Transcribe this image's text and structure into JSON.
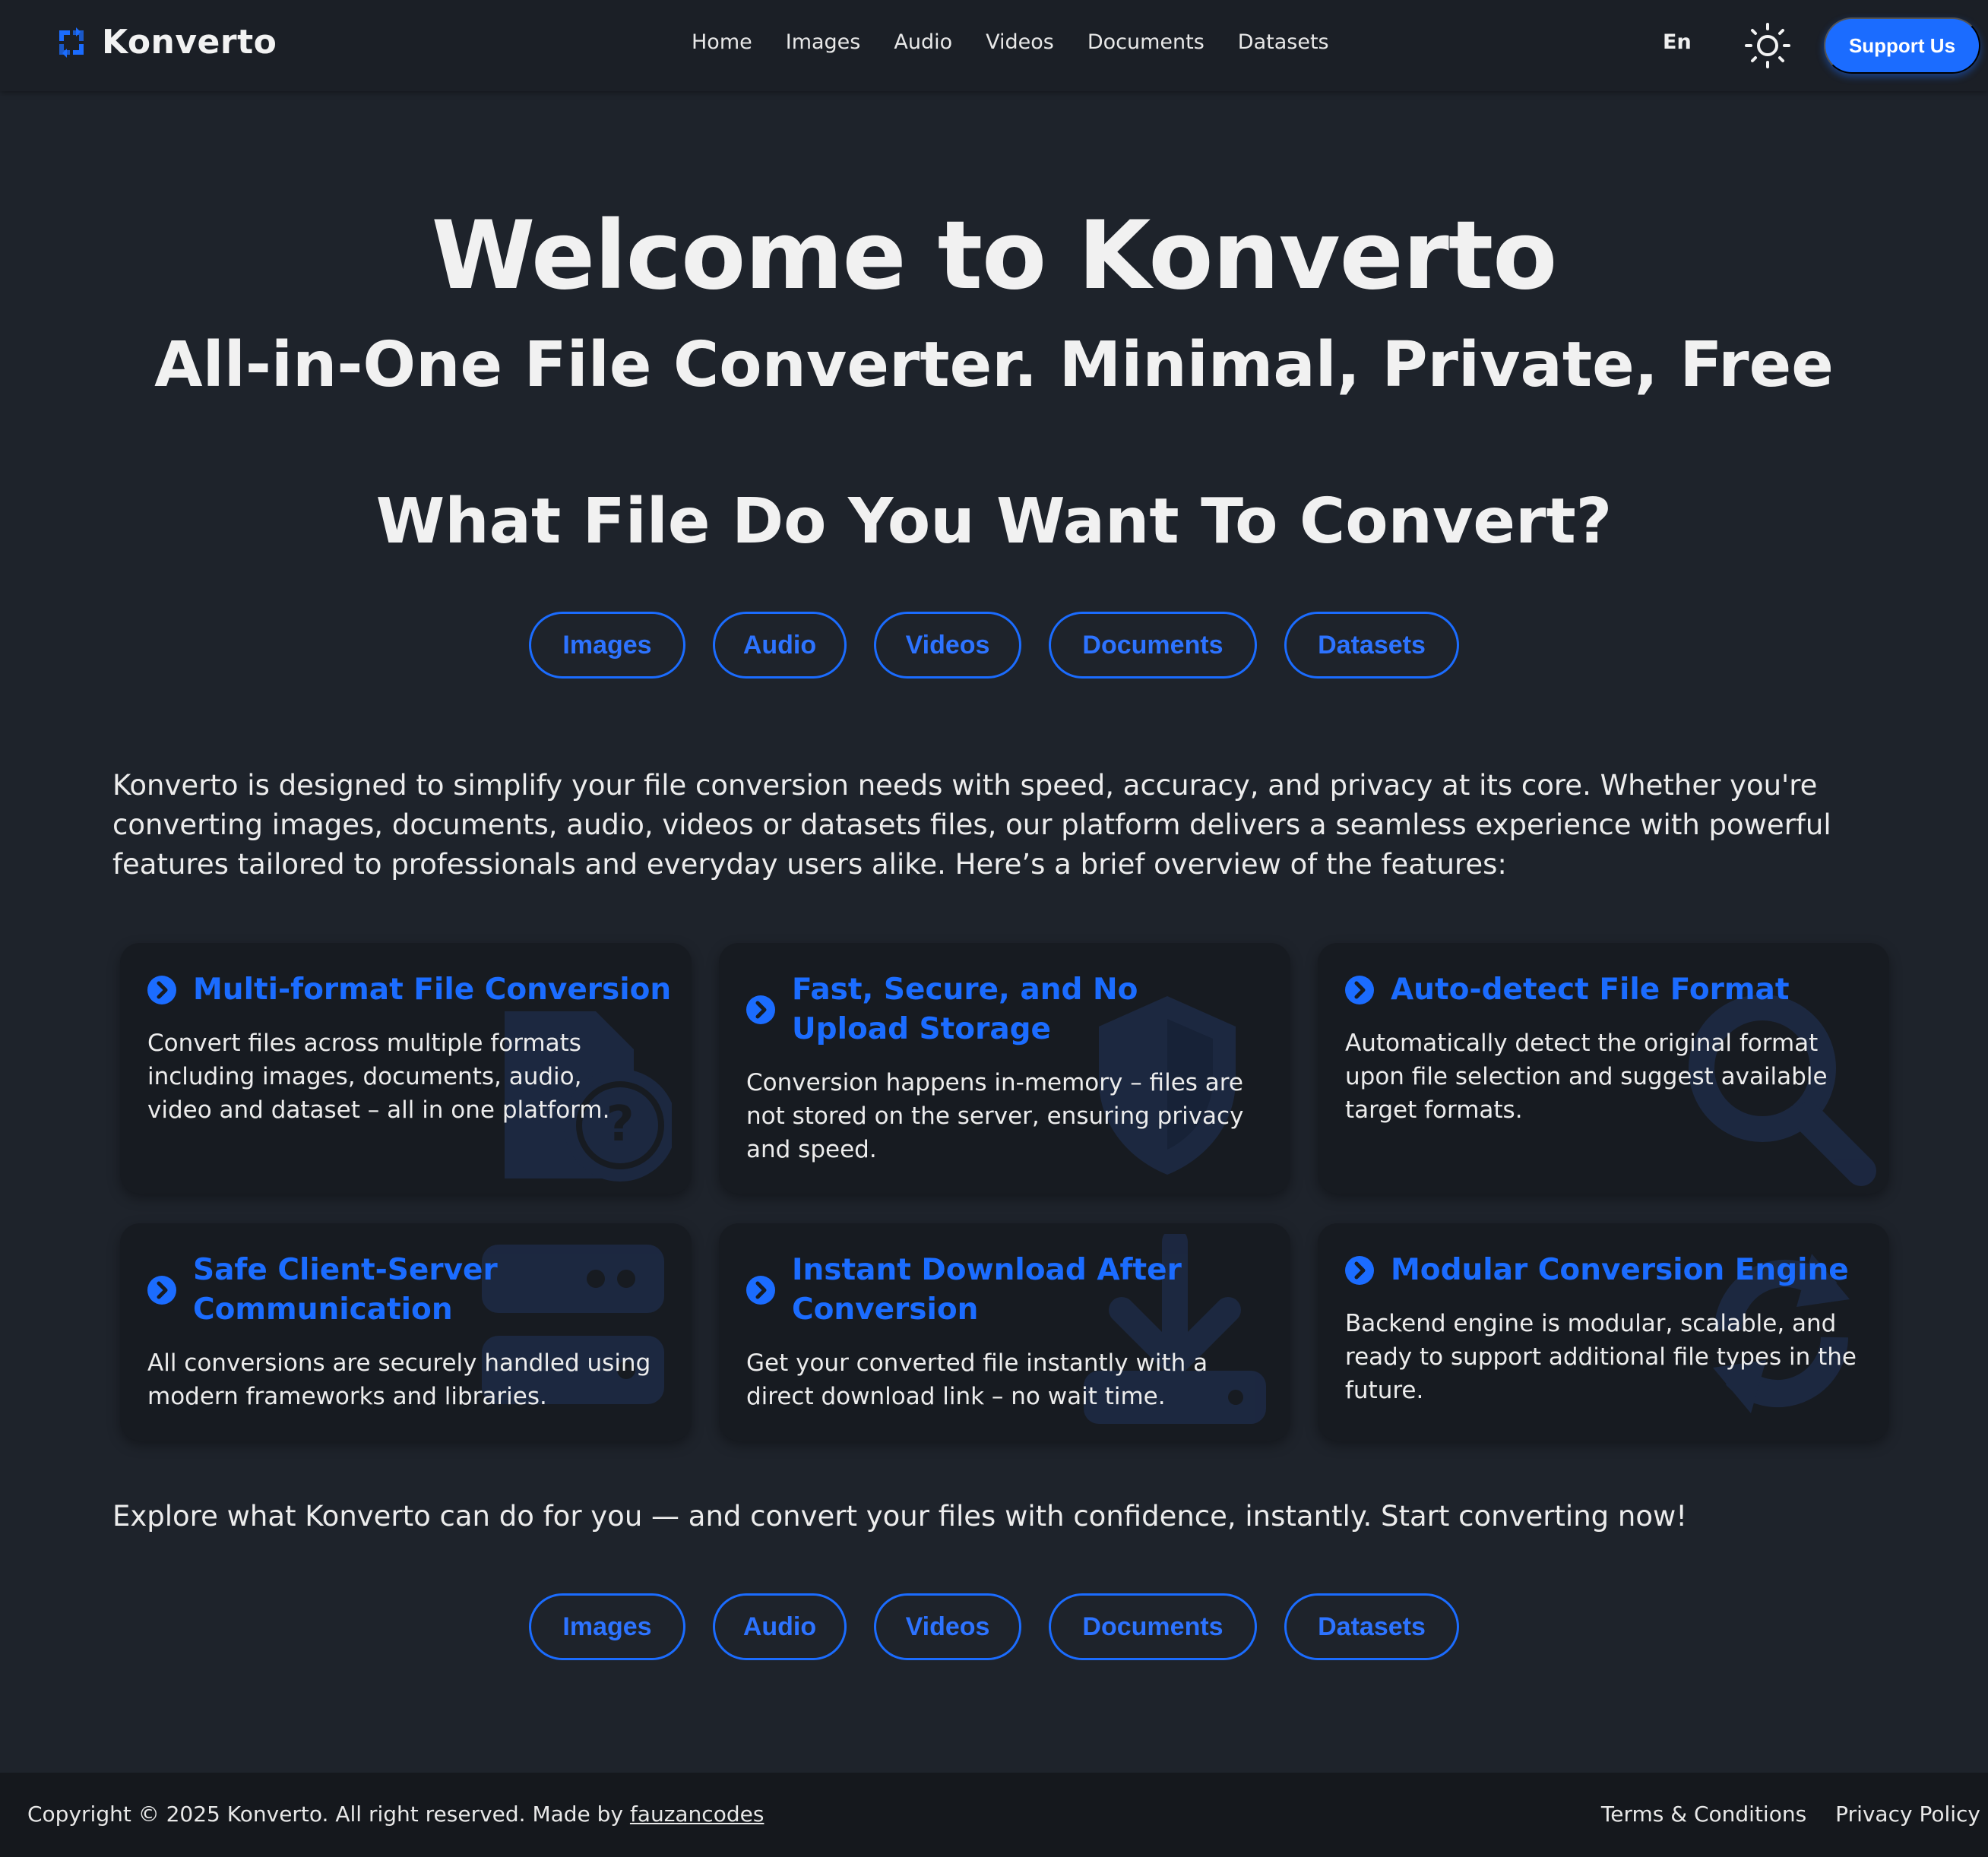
{
  "brand": {
    "name": "Konverto",
    "logo_icon": "refresh-square-icon"
  },
  "nav": {
    "links": [
      "Home",
      "Images",
      "Audio",
      "Videos",
      "Documents",
      "Datasets"
    ],
    "language": "En",
    "theme_icon": "sun-icon",
    "support_label": "Support Us"
  },
  "hero": {
    "title": "Welcome to Konverto",
    "subtitle": "All-in-One File Converter. Minimal, Private, Free",
    "question": "What File Do You Want To Convert?"
  },
  "categories": [
    "Images",
    "Audio",
    "Videos",
    "Documents",
    "Datasets"
  ],
  "intro": "Konverto is designed to simplify your file conversion needs with speed, accuracy, and privacy at its core. Whether you're converting images, documents, audio, videos or datasets files, our platform delivers a seamless experience with powerful features tailored to professionals and everyday users alike. Here’s a brief overview of the features:",
  "features": [
    {
      "title": "Multi-format File Conversion",
      "description": "Convert files across multiple formats including images, documents, audio, video and dataset – all in one platform.",
      "icon": "file-question-icon"
    },
    {
      "title": "Fast, Secure, and No Upload Storage",
      "description": "Conversion happens in-memory – files are not stored on the server, ensuring privacy and speed.",
      "icon": "shield-icon"
    },
    {
      "title": "Auto-detect File Format",
      "description": "Automatically detect the original format upon file selection and suggest available target formats.",
      "icon": "magnifier-icon"
    },
    {
      "title": "Safe Client-Server Communication",
      "description": "All conversions are securely handled using modern frameworks and libraries.",
      "icon": "server-icon"
    },
    {
      "title": "Instant Download After Conversion",
      "description": "Get your converted file instantly with a direct download link – no wait time.",
      "icon": "download-icon"
    },
    {
      "title": "Modular Conversion Engine",
      "description": "Backend engine is modular, scalable, and ready to support additional file types in the future.",
      "icon": "sync-icon"
    }
  ],
  "outro": "Explore what Konverto can do for you — and convert your files with confidence, instantly. Start converting now!",
  "footer": {
    "copyright_prefix": "Copyright © 2025 Konverto. All right reserved. Made by ",
    "author": "fauzancodes",
    "links": [
      "Terms & Conditions",
      "Privacy Policy"
    ]
  },
  "colors": {
    "accent": "#1b6cff",
    "background": "#1e232b",
    "card": "#171b21",
    "navbar": "#1b1f26",
    "footer": "#15181d"
  }
}
